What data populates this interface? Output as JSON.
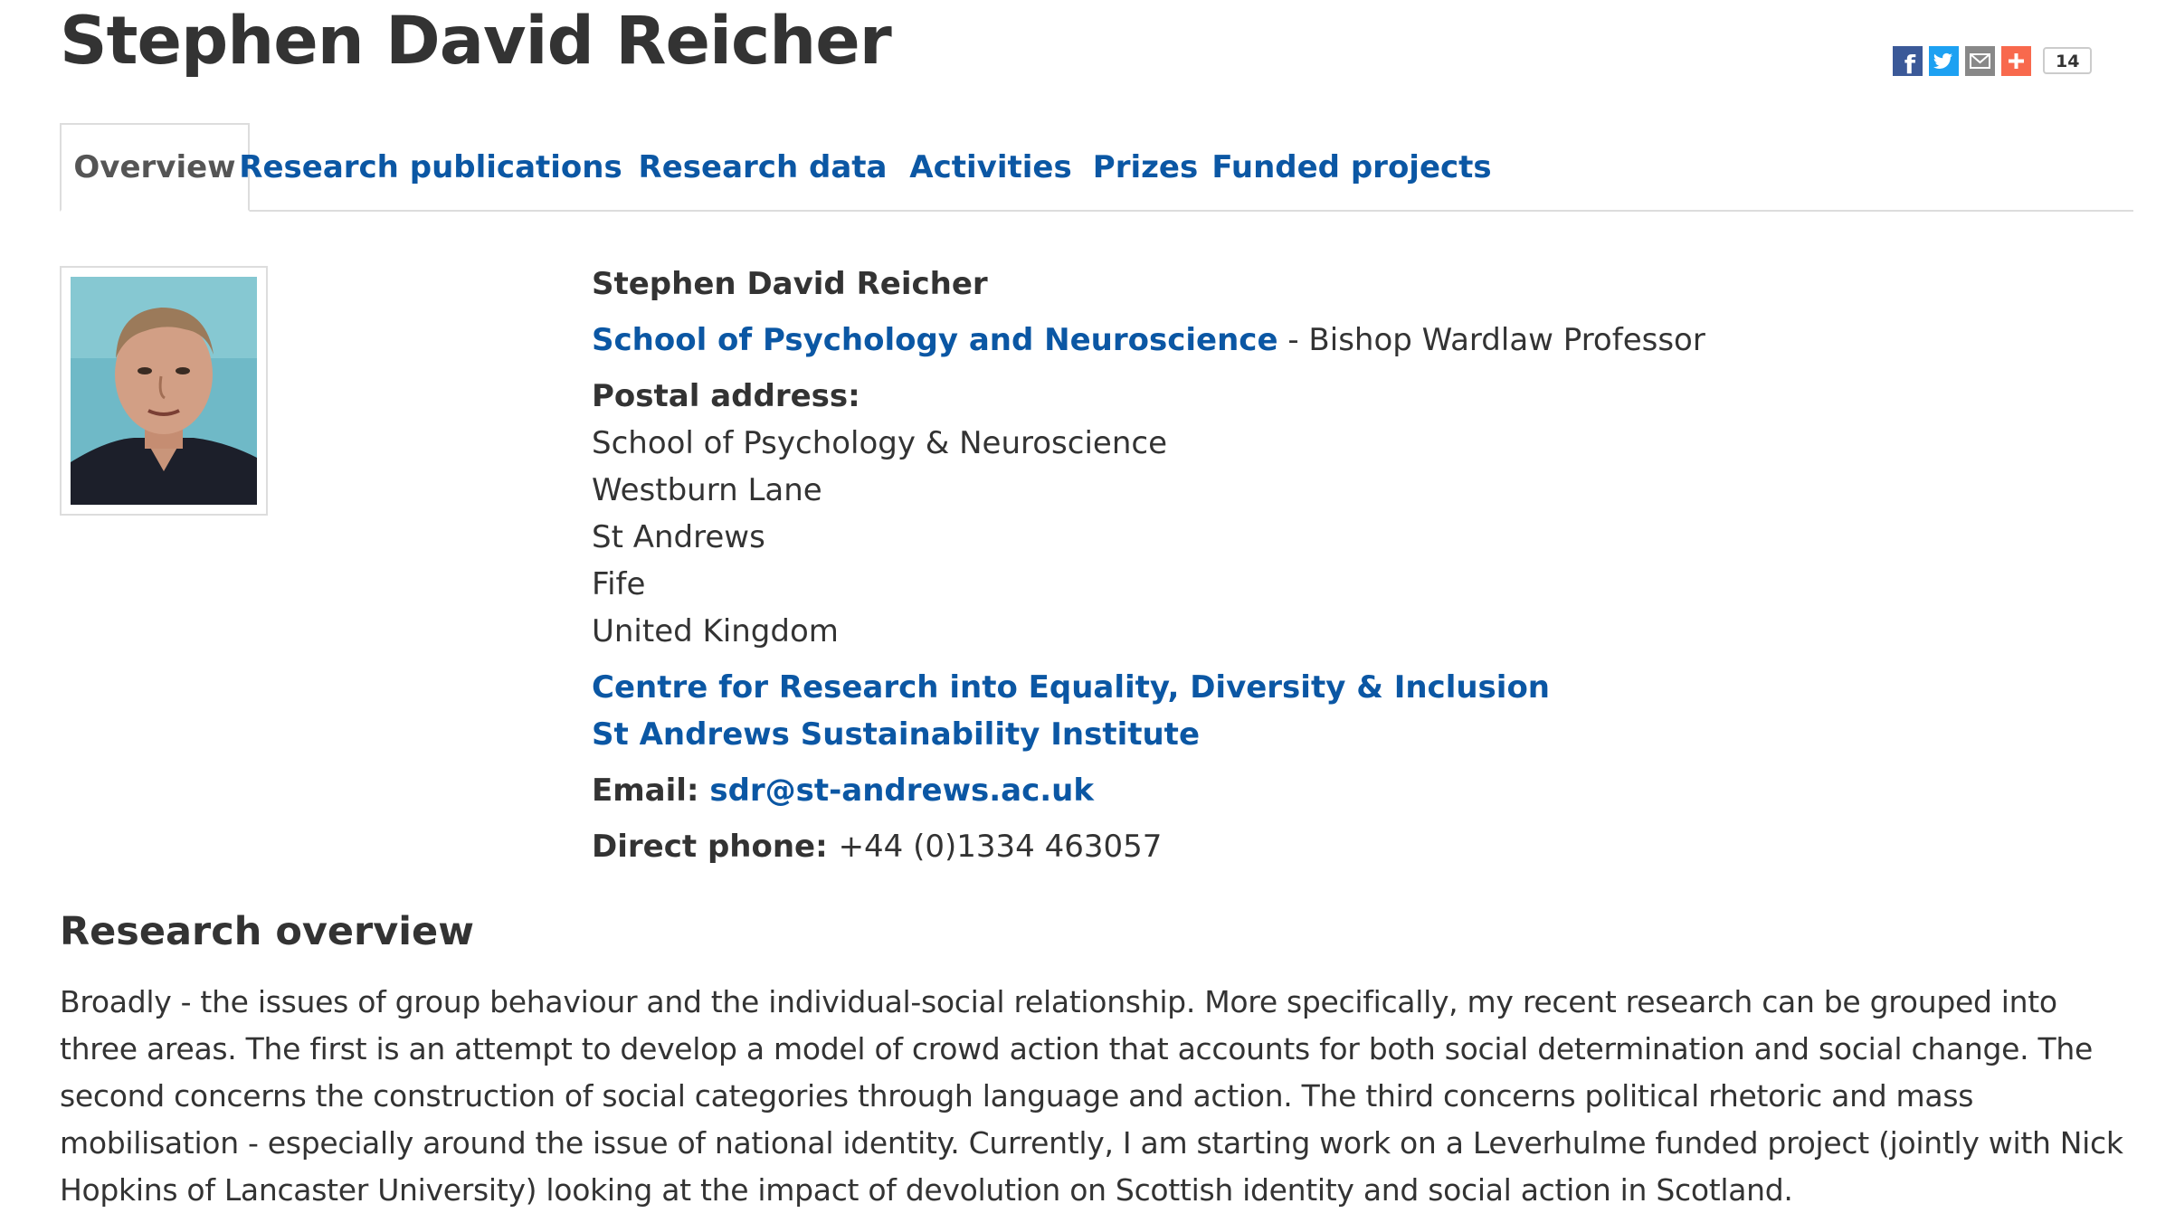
{
  "page": {
    "title": "Stephen David Reicher"
  },
  "share": {
    "facebook_icon": "facebook-icon",
    "twitter_icon": "twitter-icon",
    "email_icon": "email-icon",
    "plus_icon": "plus-icon",
    "count": "14"
  },
  "tabs": [
    {
      "label": "Overview",
      "active": true
    },
    {
      "label": "Research publications",
      "active": false
    },
    {
      "label": "Research data",
      "active": false
    },
    {
      "label": "Activities",
      "active": false
    },
    {
      "label": "Prizes",
      "active": false
    },
    {
      "label": "Funded projects",
      "active": false
    }
  ],
  "profile": {
    "name": "Stephen David Reicher",
    "school": "School of Psychology and Neuroscience",
    "separator": " - ",
    "position": "Bishop Wardlaw Professor",
    "postal_label": "Postal address:",
    "address": [
      "School of Psychology & Neuroscience",
      "Westburn Lane",
      "St Andrews",
      "Fife",
      "United Kingdom"
    ],
    "affiliations": [
      "Centre for Research into Equality, Diversity & Inclusion",
      "St Andrews Sustainability Institute"
    ],
    "email_label": "Email: ",
    "email": "sdr@st-andrews.ac.uk",
    "phone_label": "Direct phone: ",
    "phone": "+44 (0)1334 463057"
  },
  "research": {
    "heading": "Research overview",
    "text": "Broadly - the issues of group behaviour and the individual-social relationship. More specifically, my recent research can be grouped into three areas. The first is an attempt to develop a model of crowd action that accounts for both social determination and social change. The second concerns the construction of social categories through language and action. The third concerns political rhetoric and mass mobilisation - especially around the issue of national identity. Currently, I am starting work on a Leverhulme funded project (jointly with Nick Hopkins of Lancaster University) looking at the impact of devolution on Scottish identity and social action in Scotland."
  },
  "colors": {
    "link": "#0b57a4",
    "text": "#333333",
    "facebook": "#3b5998",
    "twitter": "#1da1f2",
    "email": "#888888",
    "plus": "#f8694d"
  }
}
